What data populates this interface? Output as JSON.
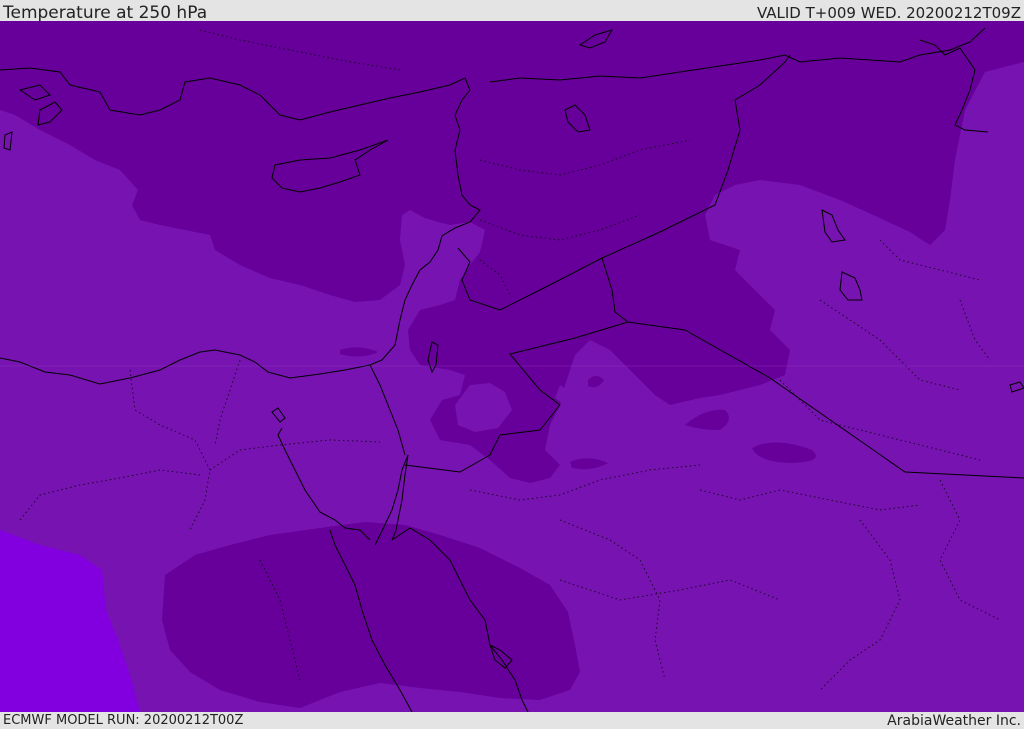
{
  "header": {
    "title": "Temperature at 250 hPa",
    "valid_time": "VALID T+009 WED. 20200212T09Z"
  },
  "footer": {
    "model_run": "ECMWF MODEL RUN: 20200212T00Z",
    "credit": "ArabiaWeather Inc."
  },
  "map": {
    "field": "temperature",
    "pressure_level": "250 hPa",
    "colors": {
      "background_band": "#7713b0",
      "cold_band": "#67009a",
      "warm_band": "#8200e0",
      "coastline": "#000000",
      "borders": "#000000"
    }
  }
}
